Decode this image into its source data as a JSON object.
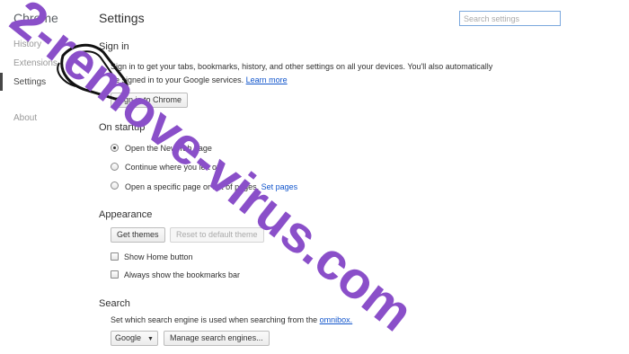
{
  "sidebar": {
    "brand": "Chrome",
    "items": [
      {
        "label": "History"
      },
      {
        "label": "Extensions"
      },
      {
        "label": "Settings"
      },
      {
        "label": "About"
      }
    ]
  },
  "header": {
    "title": "Settings",
    "search_placeholder": "Search settings"
  },
  "signin": {
    "heading": "Sign in",
    "line1": "Sign in to get your tabs, bookmarks, history, and other settings on all your devices. You'll also automatically",
    "line2": "be signed in to your Google services.",
    "learn_more": "Learn more",
    "button": "Sign in to Chrome"
  },
  "startup": {
    "heading": "On startup",
    "options": [
      {
        "label": "Open the New Tab page",
        "checked": true
      },
      {
        "label": "Continue where you left off",
        "checked": false
      },
      {
        "label": "Open a specific page or set of pages.",
        "checked": false
      }
    ],
    "set_pages": "Set pages"
  },
  "appearance": {
    "heading": "Appearance",
    "get_themes": "Get themes",
    "reset_theme": "Reset to default theme",
    "show_home": "Show Home button",
    "show_bookmarks": "Always show the bookmarks bar"
  },
  "search": {
    "heading": "Search",
    "description": "Set which search engine is used when searching from the",
    "omnibox": "omnibox.",
    "engine": "Google",
    "manage": "Manage search engines..."
  },
  "watermark": {
    "text": "2-remove-virus.com",
    "color": "#8a4fc9"
  }
}
